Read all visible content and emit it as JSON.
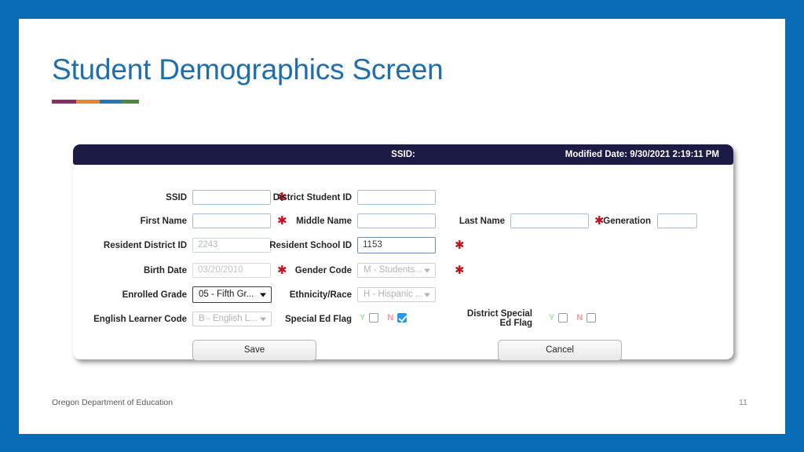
{
  "slide": {
    "title": "Student Demographics Screen",
    "accent_colors": [
      "#8E2C68",
      "#E8862C",
      "#1E7BC0",
      "#4B8B3B"
    ],
    "border_color": "#0A6CB4",
    "title_color": "#1F6FB0"
  },
  "form": {
    "header": {
      "ssid_label": "SSID:",
      "modified": "Modified Date: 9/30/2021 2:19:11 PM",
      "bar_color": "#1B1B45"
    },
    "required_marker": "✱",
    "required_marker_color": "#C0121F",
    "fields": {
      "ssid": {
        "label": "SSID",
        "value": "",
        "required": true
      },
      "district_student_id": {
        "label": "District Student ID",
        "value": "",
        "required": false
      },
      "first_name": {
        "label": "First Name",
        "value": "",
        "required": true
      },
      "middle_name": {
        "label": "Middle Name",
        "value": "",
        "required": false
      },
      "last_name": {
        "label": "Last Name",
        "value": "",
        "required": true
      },
      "generation": {
        "label": "Generation",
        "value": "",
        "required": false
      },
      "resident_district_id": {
        "label": "Resident District ID",
        "value": "2243",
        "required": false
      },
      "resident_school_id": {
        "label": "Resident School ID",
        "value": "1153",
        "required": true
      },
      "birth_date": {
        "label": "Birth Date",
        "value": "03/20/2010",
        "required": true
      },
      "gender_code": {
        "label": "Gender Code",
        "value": "M - Students...",
        "required": true
      },
      "enrolled_grade": {
        "label": "Enrolled Grade",
        "value": "05 - Fifth Gr...",
        "required": false
      },
      "ethnicity_race": {
        "label": "Ethnicity/Race",
        "value": "H - Hispanic ...",
        "required": false
      },
      "english_learner_code": {
        "label": "English Learner Code",
        "value": "B - English L...",
        "required": false
      },
      "special_ed_flag": {
        "label": "Special Ed Flag",
        "yes_label": "Y",
        "no_label": "N",
        "yes_checked": false,
        "no_checked": true
      },
      "district_special_ed_flag": {
        "label": "District Special Ed Flag",
        "yes_label": "Y",
        "no_label": "N",
        "yes_checked": false,
        "no_checked": false
      }
    },
    "buttons": {
      "save": "Save",
      "cancel": "Cancel"
    }
  },
  "footer": {
    "organization": "Oregon Department of Education",
    "page_number": "11"
  }
}
